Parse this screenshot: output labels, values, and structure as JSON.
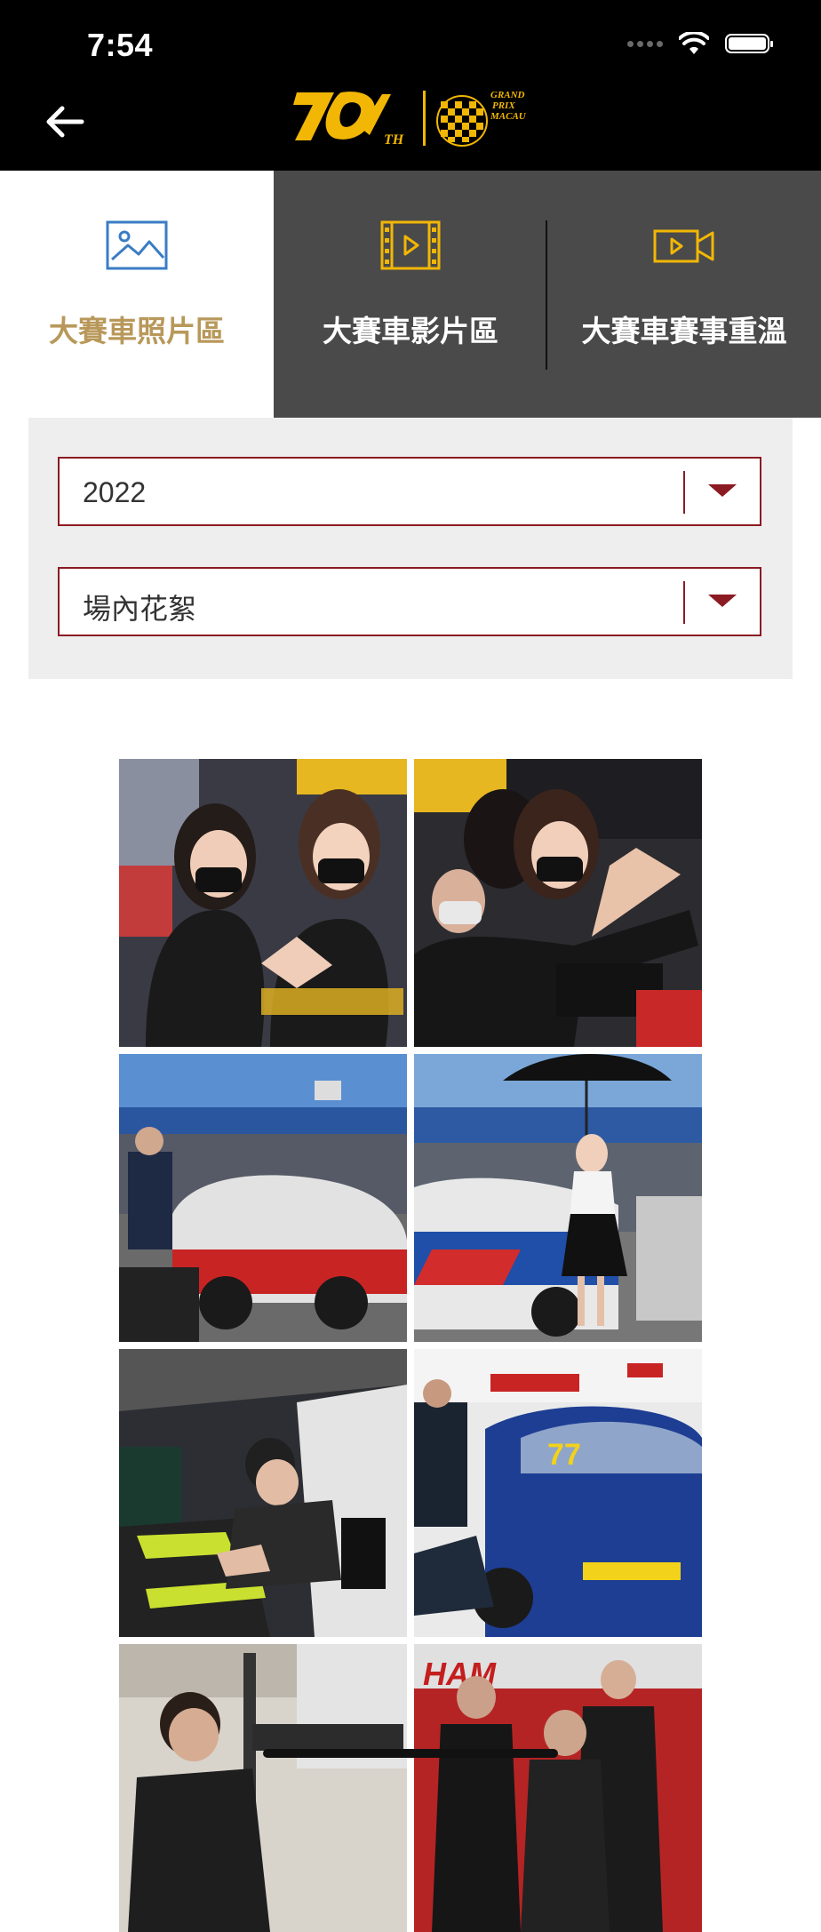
{
  "status_bar": {
    "time": "7:54"
  },
  "header": {
    "back_icon": "arrow-left-icon",
    "logo": "70th-grand-prix-macau-logo",
    "logo_text": [
      "70TH",
      "GRAND PRIX MACAU"
    ]
  },
  "tabs": [
    {
      "label": "大賽車照片區",
      "icon": "image-icon",
      "active": true
    },
    {
      "label": "大賽車影片區",
      "icon": "film-icon",
      "active": false
    },
    {
      "label": "大賽車賽事重溫",
      "icon": "video-camera-icon",
      "active": false
    }
  ],
  "filters": {
    "year": {
      "value": "2022"
    },
    "category": {
      "value": "場內花絮"
    }
  },
  "photos": [
    {
      "desc": "grid-girls"
    },
    {
      "desc": "selfie"
    },
    {
      "desc": "paddock-red-car"
    },
    {
      "desc": "umbrella-girl-blue-car"
    },
    {
      "desc": "mechanic-cockpit"
    },
    {
      "desc": "blue-car-77"
    },
    {
      "desc": "garage-crew"
    },
    {
      "desc": "team-photo"
    }
  ],
  "colors": {
    "accent_gold": "#b8985a",
    "logo_yellow": "#f2b705",
    "select_border": "#8b1a22",
    "tab_dark": "#4a4a4a"
  }
}
